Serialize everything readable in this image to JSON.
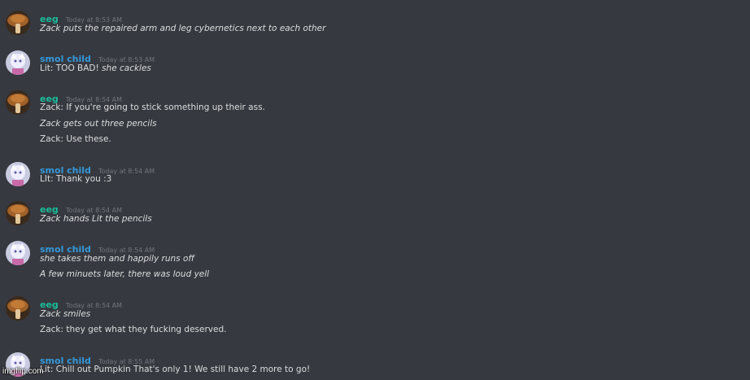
{
  "users": {
    "eeg": {
      "name": "eeg",
      "color": "#1abc9c",
      "avatar": "mushroom-avatar-icon"
    },
    "smol": {
      "name": "smol child",
      "color": "#3498db",
      "avatar": "anime-character-avatar-icon"
    }
  },
  "messages": [
    {
      "author": "eeg",
      "timestamp": "Today at 8:53 AM",
      "lines": [
        {
          "text": "Zack puts the repaired arm and leg cybernetics next to each other",
          "italic": true
        }
      ]
    },
    {
      "author": "smol child",
      "timestamp": "Today at 8:53 AM",
      "lines": [
        {
          "prefix": "Lit: TOO BAD! ",
          "emphasis": "she cackles"
        }
      ]
    },
    {
      "author": "eeg",
      "timestamp": "Today at 8:54 AM",
      "lines": [
        {
          "text": "Zack: If you're going to stick something up their ass.",
          "italic": false
        },
        {
          "text": "Zack gets out three pencils",
          "italic": true
        },
        {
          "text": "Zack: Use these.",
          "italic": false
        }
      ]
    },
    {
      "author": "smol child",
      "timestamp": "Today at 8:54 AM",
      "lines": [
        {
          "text": "LIt: Thank you :3",
          "italic": false
        }
      ]
    },
    {
      "author": "eeg",
      "timestamp": "Today at 8:54 AM",
      "lines": [
        {
          "text": "Zack hands Lit the pencils",
          "italic": true
        }
      ]
    },
    {
      "author": "smol child",
      "timestamp": "Today at 8:54 AM",
      "lines": [
        {
          "text": "she takes them and happily runs off",
          "italic": true
        },
        {
          "text": "A few minuets later, there was loud yell",
          "italic": true
        }
      ]
    },
    {
      "author": "eeg",
      "timestamp": "Today at 8:54 AM",
      "lines": [
        {
          "text": "Zack smiles",
          "italic": true
        },
        {
          "text": "Zack: they get what they fucking deserved.",
          "italic": false
        }
      ]
    },
    {
      "author": "smol child",
      "timestamp": "Today at 8:55 AM",
      "lines": [
        {
          "text": "Lit: Chill out Pumpkin That's only 1! We still have 2 more to go!",
          "italic": false
        }
      ]
    }
  ],
  "watermark": "imgflip.com",
  "colors": {
    "background": "#36393f",
    "message_text": "#dcddde",
    "timestamp": "#72767d"
  }
}
